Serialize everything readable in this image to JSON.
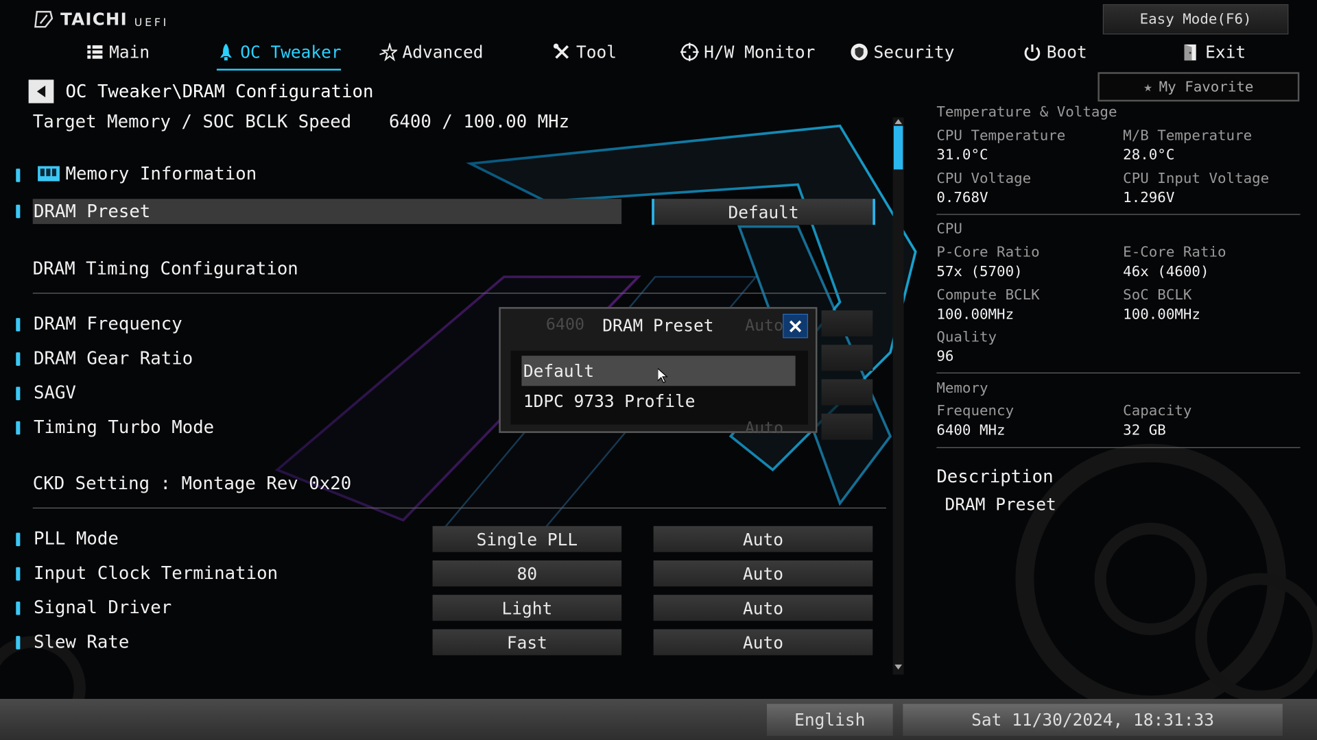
{
  "header": {
    "brand": "TAICHI",
    "brand_sub": "UEFI",
    "easy_mode": "Easy Mode(F6)",
    "my_favorite": "My Favorite"
  },
  "nav": [
    {
      "label": "Main",
      "icon": "list-icon"
    },
    {
      "label": "OC Tweaker",
      "icon": "rocket-icon",
      "active": true
    },
    {
      "label": "Advanced",
      "icon": "star-icon"
    },
    {
      "label": "Tool",
      "icon": "tools-icon"
    },
    {
      "label": "H/W Monitor",
      "icon": "crosshair-icon"
    },
    {
      "label": "Security",
      "icon": "shield-icon"
    },
    {
      "label": "Boot",
      "icon": "power-icon"
    },
    {
      "label": "Exit",
      "icon": "exit-door-icon"
    }
  ],
  "breadcrumb": "OC Tweaker\\DRAM Configuration",
  "target": {
    "label": "Target Memory / SOC BCLK Speed",
    "value": "6400 / 100.00 MHz"
  },
  "memory_info": "Memory Information",
  "dram_preset": {
    "label": "DRAM Preset",
    "value": "Default"
  },
  "dram_timing_config": "DRAM Timing Configuration",
  "timing_rows": [
    {
      "label": "DRAM Frequency"
    },
    {
      "label": "DRAM Gear Ratio"
    },
    {
      "label": "SAGV"
    },
    {
      "label": "Timing Turbo Mode"
    }
  ],
  "ghost": {
    "freq": "6400",
    "auto1": "Auto",
    "auto2": "Auto"
  },
  "ckd_setting": "CKD Setting : Montage Rev 0x20",
  "ckd_rows": [
    {
      "label": "PLL Mode",
      "current": "Single PLL",
      "value": "Auto"
    },
    {
      "label": "Input Clock Termination",
      "current": "80",
      "value": "Auto"
    },
    {
      "label": "Signal Driver",
      "current": "Light",
      "value": "Auto"
    },
    {
      "label": "Slew Rate",
      "current": "Fast",
      "value": "Auto"
    }
  ],
  "sidebar": {
    "tv_title": "Temperature & Voltage",
    "cpu_temp_label": "CPU Temperature",
    "cpu_temp": "31.0°C",
    "mb_temp_label": "M/B Temperature",
    "mb_temp": "28.0°C",
    "cpu_volt_label": "CPU Voltage",
    "cpu_volt": "0.768V",
    "cpu_in_volt_label": "CPU Input Voltage",
    "cpu_in_volt": "1.296V",
    "cpu_title": "CPU",
    "pcore_label": "P-Core Ratio",
    "pcore": "57x (5700)",
    "ecore_label": "E-Core Ratio",
    "ecore": "46x (4600)",
    "cbclk_label": "Compute BCLK",
    "cbclk": "100.00MHz",
    "socbclk_label": "SoC BCLK",
    "socbclk": "100.00MHz",
    "quality_label": "Quality",
    "quality": "96",
    "mem_title": "Memory",
    "freq_label": "Frequency",
    "freq": "6400 MHz",
    "cap_label": "Capacity",
    "cap": "32 GB",
    "desc_title": "Description",
    "desc_text": "DRAM Preset"
  },
  "popup": {
    "title": "DRAM Preset",
    "options": [
      "Default",
      "1DPC 9733 Profile"
    ],
    "selected_index": 0
  },
  "footer": {
    "language": "English",
    "datetime": "Sat 11/30/2024, 18:31:33"
  },
  "colors": {
    "accent": "#2ad1ff",
    "marker": "#3cc8f5"
  }
}
